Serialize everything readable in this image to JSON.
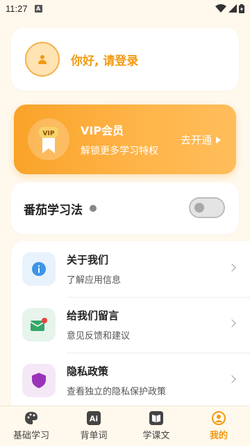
{
  "status_bar": {
    "time": "11:27",
    "notification_glyph": "A"
  },
  "profile": {
    "greeting": "你好, 请登录"
  },
  "vip": {
    "title": "VIP会员",
    "subtitle": "解锁更多学习特权",
    "badge": "VIP",
    "action": "去开通"
  },
  "tomato": {
    "label": "番茄学习法",
    "enabled": false
  },
  "menu": {
    "items": [
      {
        "title": "关于我们",
        "subtitle": "了解应用信息",
        "icon": "info-icon"
      },
      {
        "title": "给我们留言",
        "subtitle": "意见反馈和建议",
        "icon": "mail-icon"
      },
      {
        "title": "隐私政策",
        "subtitle": "查看独立的隐私保护政策",
        "icon": "shield-icon"
      }
    ]
  },
  "tabs": [
    {
      "label": "基础学习",
      "icon": "palette-icon",
      "active": false
    },
    {
      "label": "背单词",
      "icon": "ai-icon",
      "icon_text": "Ai",
      "active": false
    },
    {
      "label": "学课文",
      "icon": "book-icon",
      "active": false
    },
    {
      "label": "我的",
      "icon": "profile-icon",
      "active": true
    }
  ],
  "colors": {
    "accent": "#f29a12",
    "vip_gradient_start": "#f9a329",
    "background": "#fff8ec"
  }
}
